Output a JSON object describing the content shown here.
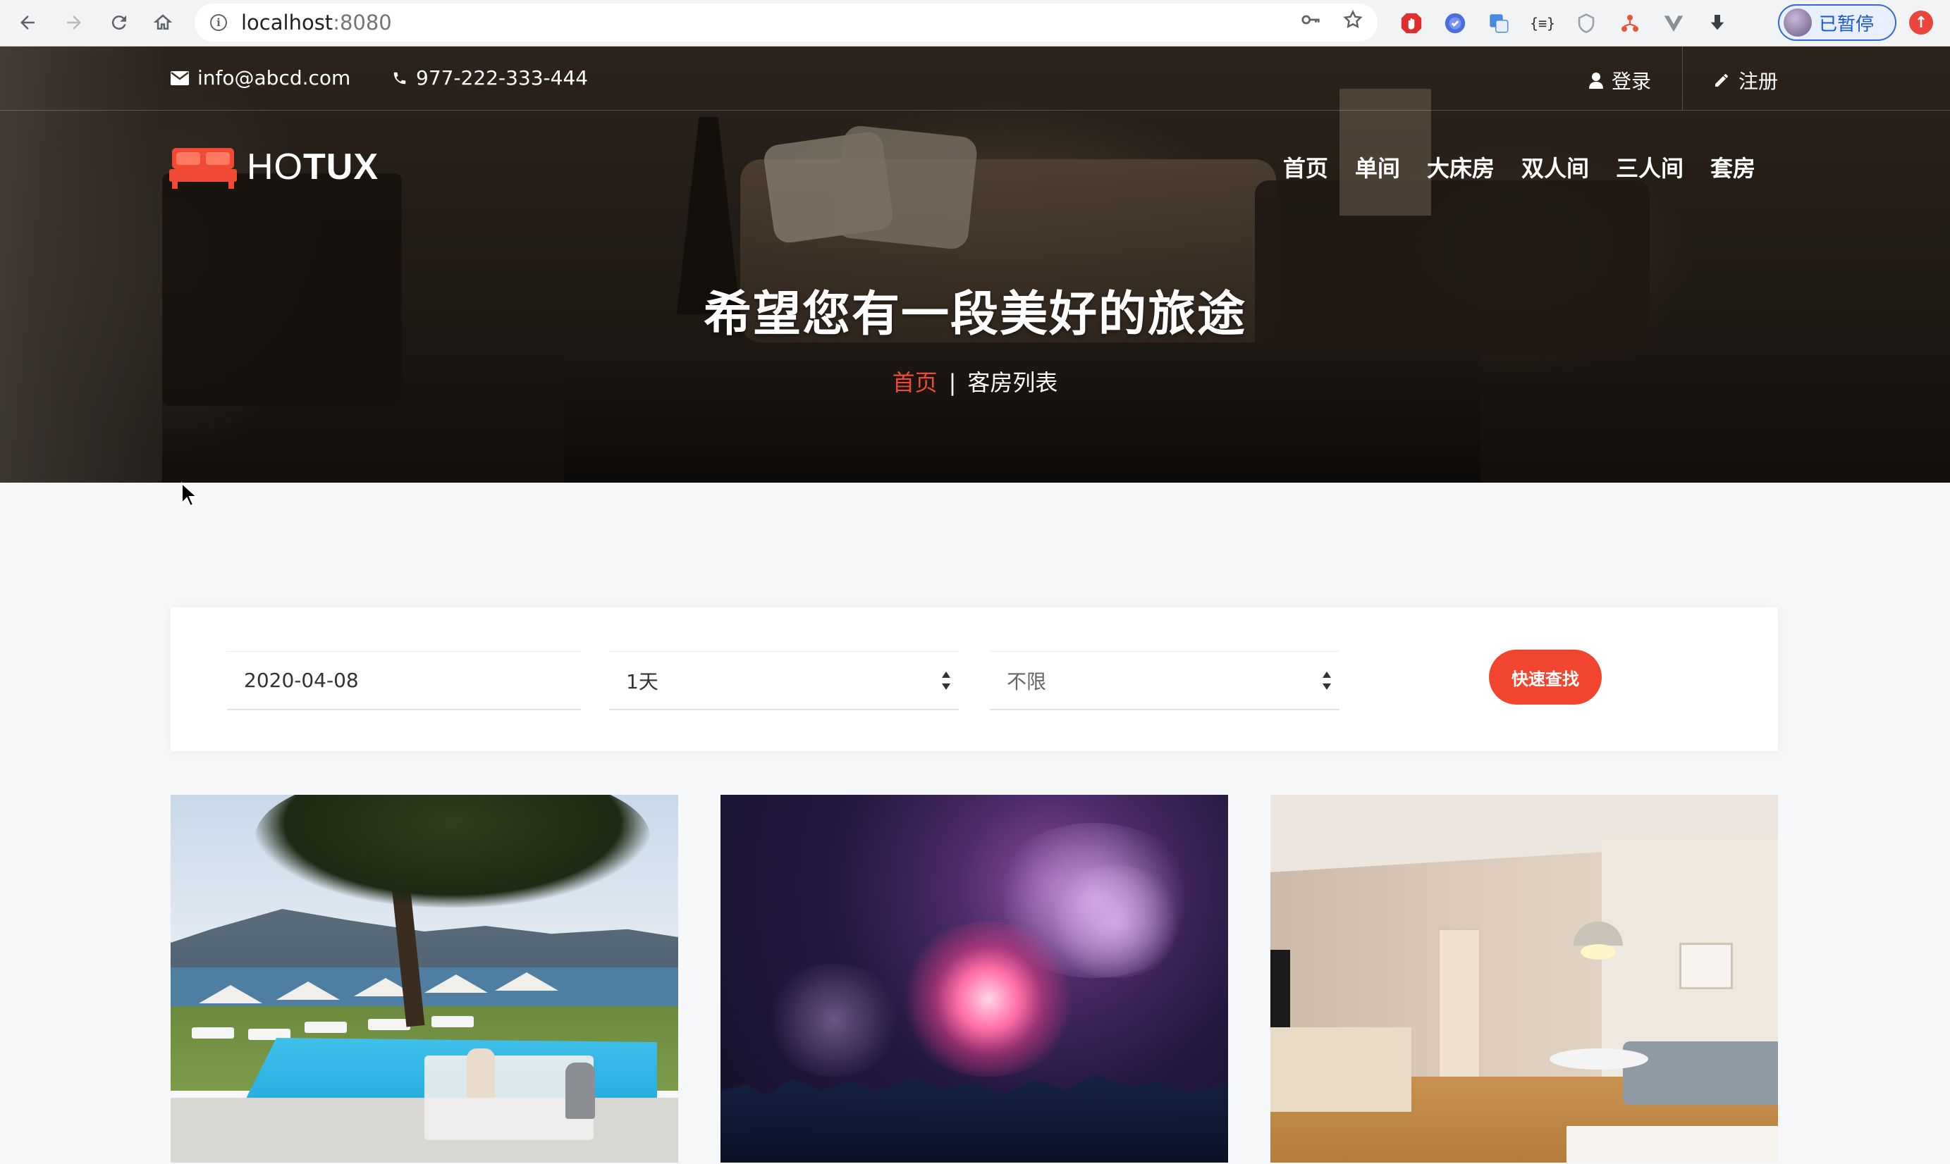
{
  "browser": {
    "url_host": "localhost",
    "url_port": ":8080",
    "profile_label": "已暂停",
    "toolbar_icons": [
      "back-icon",
      "forward-icon",
      "reload-icon",
      "home-icon",
      "info-icon",
      "key-icon",
      "star-icon"
    ],
    "extension_icons": [
      "adblock-icon",
      "extension-blue-icon",
      "translate-icon",
      "json-viewer-icon",
      "shield-icon",
      "network-icon",
      "vue-devtools-icon",
      "download-icon"
    ]
  },
  "topbar": {
    "email": "info@abcd.com",
    "phone": "977-222-333-444",
    "login": "登录",
    "register": "注册"
  },
  "logo": {
    "text_light": "HO",
    "text_bold": "TUX",
    "color": "#f04a36"
  },
  "nav": {
    "items": [
      "首页",
      "单间",
      "大床房",
      "双人间",
      "三人间",
      "套房"
    ]
  },
  "hero": {
    "title": "希望您有一段美好的旅途",
    "breadcrumb_home": "首页",
    "breadcrumb_sep": "|",
    "breadcrumb_current": "客房列表"
  },
  "search": {
    "date_value": "2020-04-08",
    "days_value": "1天",
    "type_value": "不限",
    "button_label": "快速查找",
    "accent_color": "#f2452f"
  },
  "cards": [
    {
      "image": "pool-resort-photo"
    },
    {
      "image": "fireworks-concert-photo"
    },
    {
      "image": "hotel-room-photo"
    }
  ]
}
